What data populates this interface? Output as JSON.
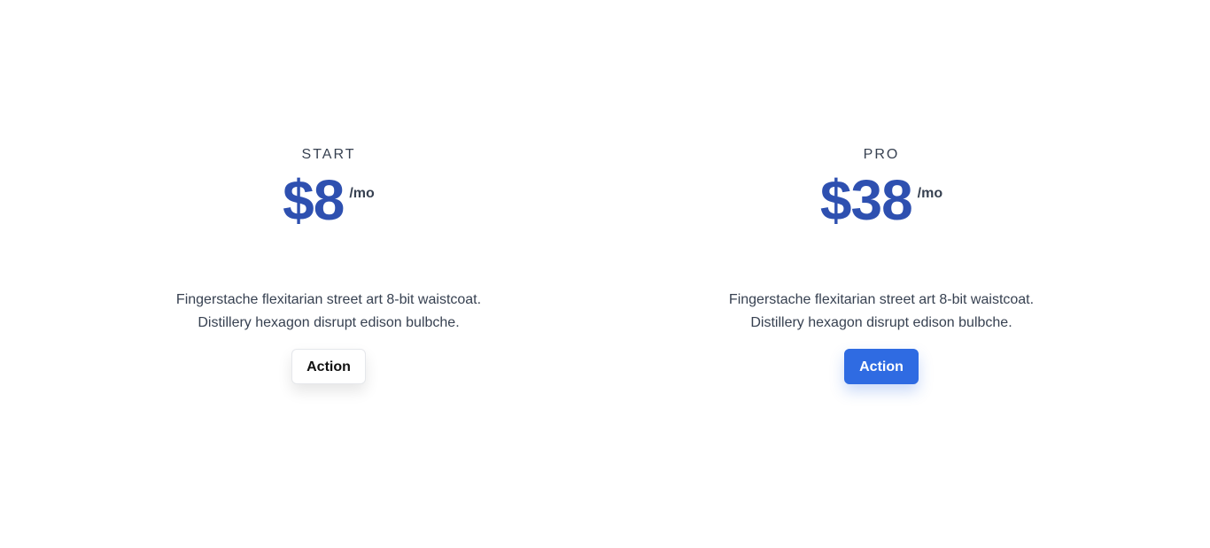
{
  "plans": [
    {
      "name": "START",
      "price": "$8",
      "period": "/mo",
      "description": [
        "Fingerstache flexitarian street art 8-bit waistcoat.",
        "Distillery hexagon disrupt edison bulbche."
      ],
      "action_label": "Action"
    },
    {
      "name": "PRO",
      "price": "$38",
      "period": "/mo",
      "description": [
        "Fingerstache flexitarian street art 8-bit waistcoat.",
        "Distillery hexagon disrupt edison bulbche."
      ],
      "action_label": "Action"
    }
  ],
  "colors": {
    "price": "#2e50b0",
    "primary_button": "#2f6be2",
    "text": "#374151"
  }
}
